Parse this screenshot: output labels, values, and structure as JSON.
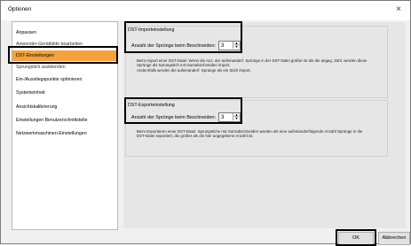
{
  "window": {
    "title": "Optionen",
    "close_glyph": "×"
  },
  "sidebar": {
    "items": [
      {
        "label": "Anpassen"
      },
      {
        "label": "Anwender-Gerätbilde bearbeiten"
      },
      {
        "label": "DST-Einstellungen"
      },
      {
        "label": "Sprungstich ausblenden"
      },
      {
        "label": "Ein-/Ausstiegspunkte optimieren"
      },
      {
        "label": "Systemeinheit"
      },
      {
        "label": "Ansichtskalibrierung"
      },
      {
        "label": "Einstellungen Benutzerschnittstelle"
      },
      {
        "label": "Netzwerkmaschinen-Einstellungen"
      }
    ],
    "selected": "DST-Einstellungen"
  },
  "import_group": {
    "title": "DST-Importeinstellung",
    "field_label": "Anzahl der Sprünge beim Beschneiden:",
    "value": "3",
    "description": "Beim Import einer DST-Datei: Wenn die Anz. der aufeinanderf. Sprünge in der DST-Datei größer ist als die angeg. Zahl, werden diese Sprünge als Sprungstich mit Garnabschneiden import.\nAndernfalls werden die aufeinanderf. Sprünge als ein Stich import."
  },
  "export_group": {
    "title": "DST-Exporteinstellung",
    "field_label": "Anzahl der Sprünge beim Beschneiden:",
    "value": "3",
    "description": "Beim Exportieren einer DST-Datei: Sprungstiche mit Garnabschneiden werden als eine aufeinanderfolgende Anzahl Sprünge in die DST-Datei exportiert, die größer als die hier angegebene Anzahl ist."
  },
  "buttons": {
    "ok": "OK",
    "cancel": "Abbrechen"
  },
  "icons": {
    "spin_up": "▲",
    "spin_down": "▼"
  }
}
